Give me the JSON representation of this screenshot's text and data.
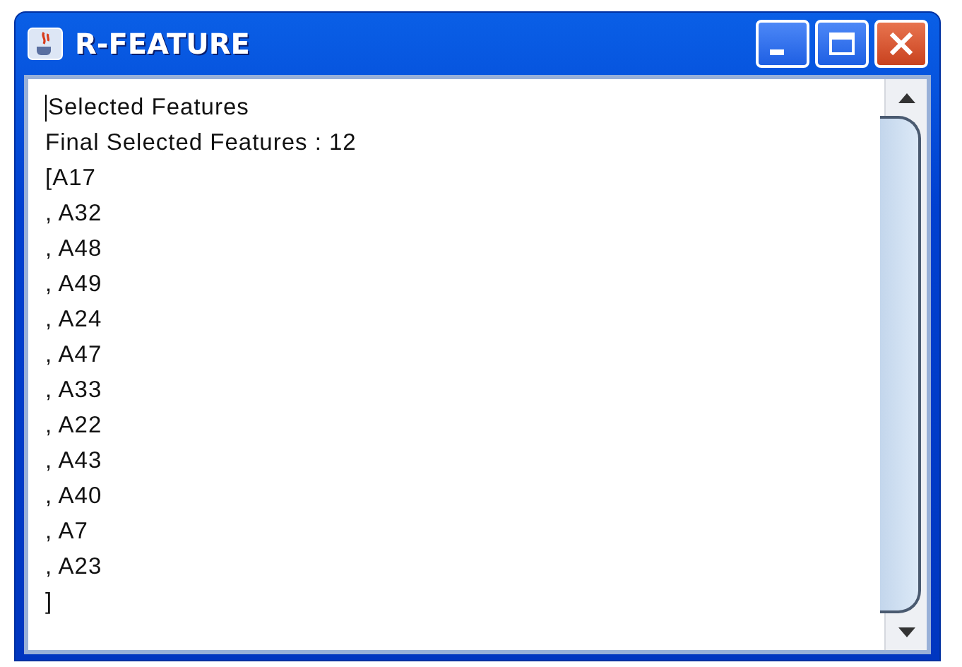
{
  "window": {
    "title": "R-FEATURE"
  },
  "title_buttons": [
    {
      "kind": "minimize"
    },
    {
      "kind": "maximize"
    },
    {
      "kind": "close"
    }
  ],
  "text_area": {
    "lines": [
      "Selected Features",
      "Final Selected Features : 12",
      "[A17",
      ", A32",
      ", A48",
      ", A49",
      ", A24",
      ", A47",
      ", A33",
      ", A22",
      ", A43",
      ", A40",
      ", A7",
      ", A23",
      "]"
    ]
  }
}
